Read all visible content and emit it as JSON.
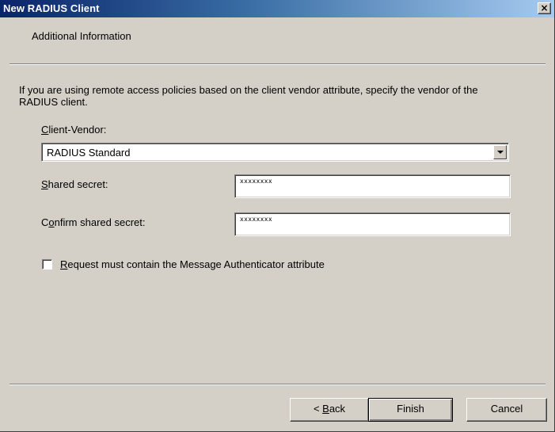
{
  "window": {
    "title": "New RADIUS Client",
    "close_label": "×"
  },
  "header": {
    "title": "Additional Information"
  },
  "description": "If you are using remote access policies based on the client vendor attribute, specify the vendor of the RADIUS client.",
  "client_vendor": {
    "label_hotkey": "C",
    "label_rest": "lient-Vendor:",
    "selected_value": "RADIUS Standard"
  },
  "shared_secret": {
    "label_hotkey": "S",
    "label_rest": "hared secret:",
    "value": "xxxxxxxx"
  },
  "confirm_secret": {
    "label_pre": "C",
    "label_hotkey": "o",
    "label_rest": "nfirm shared secret:",
    "value": "xxxxxxxx"
  },
  "authenticator": {
    "label_hotkey": "R",
    "label_rest": "equest must contain the Message Authenticator attribute",
    "checked": false
  },
  "buttons": {
    "back_pre": "< ",
    "back_hotkey": "B",
    "back_rest": "ack",
    "finish": "Finish",
    "cancel": "Cancel"
  }
}
